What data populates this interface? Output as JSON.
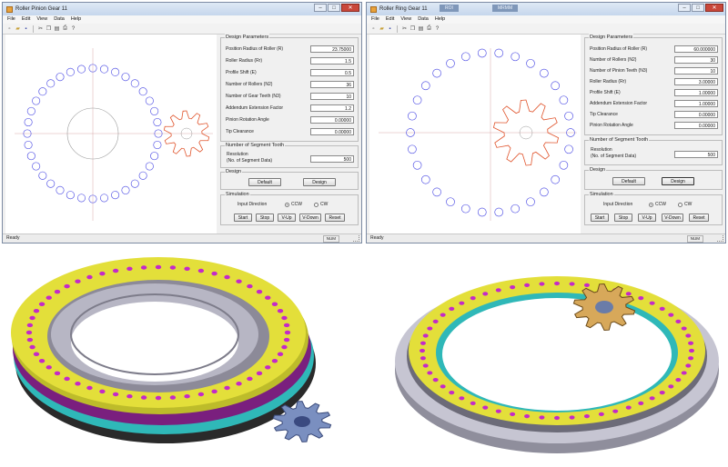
{
  "left_app": {
    "title": "Roller Pinion Gear 11",
    "menu": [
      "File",
      "Edit",
      "View",
      "Data",
      "Help"
    ],
    "design_parameters": {
      "group_title": "Design Parameters",
      "rows": [
        {
          "label": "Position Radius of Roller (R)",
          "value": "23.75000"
        },
        {
          "label": "Roller Radius (Rr)",
          "value": "1.5"
        },
        {
          "label": "Profile Shift (E)",
          "value": "0.5"
        },
        {
          "label": "Number of Rollers (N2)",
          "value": "36"
        },
        {
          "label": "Number of Gear Teeth (N3)",
          "value": "10"
        },
        {
          "label": "Addendum Extension Factor",
          "value": "1.2"
        },
        {
          "label": "Pinion Rotation Angle",
          "value": "0.00000"
        },
        {
          "label": "Tip Clearance",
          "value": "0.00000"
        }
      ]
    },
    "segment": {
      "group_title": "Number of Segment Tooth",
      "label1": "Resolution",
      "label2": "(No. of Segment Data)",
      "value": "500"
    },
    "design": {
      "group_title": "Design",
      "default_label": "Default",
      "design_label": "Design"
    },
    "simulation": {
      "group_title": "Simulation",
      "input_direction": "Input Direction",
      "ccw": "CCW",
      "cw": "CW",
      "buttons": [
        "Start",
        "Stop",
        "V-Up",
        "V-Down",
        "Reset"
      ]
    },
    "status": {
      "ready": "Ready",
      "num": "NUM"
    }
  },
  "right_app": {
    "title": "Roller Ring Gear 11",
    "taskbar_items": [
      "ROI",
      "MRMM"
    ],
    "menu": [
      "File",
      "Edit",
      "View",
      "Data",
      "Help"
    ],
    "design_parameters": {
      "group_title": "Design Parameters",
      "rows": [
        {
          "label": "Position Radius of Roller (R)",
          "value": "60.000000"
        },
        {
          "label": "Number of Rollers (N2)",
          "value": "30"
        },
        {
          "label": "Number of Pinion Teeth (N3)",
          "value": "10"
        },
        {
          "label": "Roller Radius (Rr)",
          "value": "3.00000"
        },
        {
          "label": "Profile Shift (E)",
          "value": "1.00000"
        },
        {
          "label": "Addendum Extension Factor",
          "value": "1.00000"
        },
        {
          "label": "Tip Clearance",
          "value": "0.00000"
        },
        {
          "label": "Pinion Rotation Angle",
          "value": "0.00000"
        }
      ]
    },
    "segment": {
      "group_title": "Number of Segment Tooth",
      "label1": "Resolution",
      "label2": "(No. of Segment Data)",
      "value": "500"
    },
    "design": {
      "group_title": "Design",
      "default_label": "Default",
      "design_label": "Design"
    },
    "simulation": {
      "group_title": "Simulation",
      "input_direction": "Input Direction",
      "ccw": "CCW",
      "cw": "CW",
      "buttons": [
        "Start",
        "Stop",
        "V-Up",
        "V-Down",
        "Reset"
      ]
    },
    "status": {
      "ready": "Ready",
      "num": "NUM"
    }
  },
  "colors": {
    "roller_circle": "#5a5ae6",
    "gear_profile": "#e0542c",
    "ring_yellow": "#e3df3a",
    "ring_base": "#8c8a98",
    "pin_magenta": "#c42ac8",
    "teal_band": "#2fb8b8"
  },
  "icons": [
    "new-file-icon",
    "open-folder-icon",
    "save-icon",
    "cut-icon",
    "copy-icon",
    "paste-icon",
    "print-icon",
    "help-icon"
  ]
}
